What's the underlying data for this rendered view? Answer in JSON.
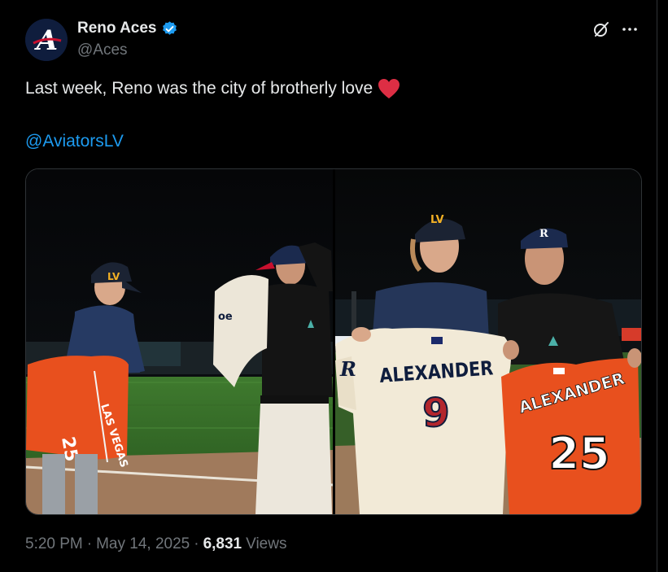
{
  "tweet": {
    "author": {
      "display_name": "Reno Aces",
      "handle": "@Aces",
      "verified": true,
      "avatar_letter": "A"
    },
    "text": "Last week, Reno was the city of brotherly love",
    "emoji": "red-heart",
    "mention": "@AviatorsLV",
    "media": [
      {
        "jerseys": [
          {
            "team_lettering": "LAS VEGAS",
            "number": "25",
            "color": "#e8501e"
          }
        ],
        "cap_logos": [
          "LV"
        ]
      },
      {
        "jerseys": [
          {
            "name": "ALEXANDER",
            "number": "9",
            "color": "#f2ead7",
            "sleeve_letter": "R"
          },
          {
            "name": "ALEXANDER",
            "number": "25",
            "color": "#e8501e"
          }
        ],
        "cap_logos": [
          "LV",
          "R"
        ]
      }
    ],
    "time": "5:20 PM",
    "date": "May 14, 2025",
    "views_count": "6,831",
    "views_label": "Views",
    "separator": "·"
  },
  "colors": {
    "accent": "#1d9bf0",
    "text": "#e7e9ea",
    "muted": "#71767b",
    "heart": "#f91880",
    "background": "#000000"
  },
  "icons": [
    "verified-badge-icon",
    "grok-icon",
    "more-icon",
    "heart-emoji-icon"
  ]
}
